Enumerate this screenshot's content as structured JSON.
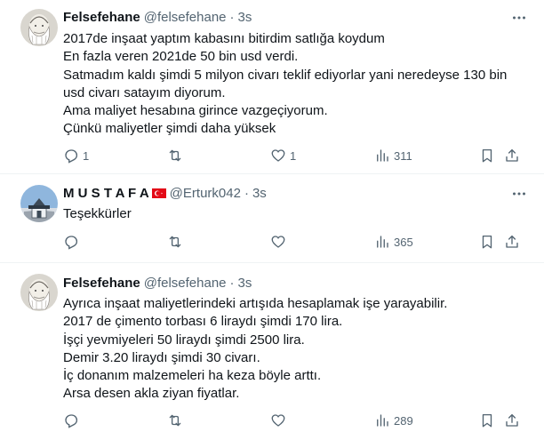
{
  "tweets": [
    {
      "name": "Felsefehane",
      "handle": "@felsefehane",
      "dot": "·",
      "time": "3s",
      "lines": [
        "2017de inşaat yaptım kabasını bitirdim satlığa koydum",
        "En fazla veren 2021de 50 bin usd verdi.",
        "Satmadım kaldı şimdi 5 milyon civarı teklif ediyorlar yani neredeyse 130 bin",
        "usd civarı satayım diyorum.",
        "Ama maliyet hesabına girince vazgeçiyorum.",
        "Çünkü maliyetler şimdi daha yüksek"
      ],
      "reply_count": "1",
      "retweet_count": "",
      "like_count": "1",
      "view_count": "311"
    },
    {
      "name": "M U S T A F A",
      "flag_icon": "turkey-flag-icon",
      "handle": "@Erturk042",
      "dot": "·",
      "time": "3s",
      "lines": [
        "Teşekkürler"
      ],
      "reply_count": "",
      "retweet_count": "",
      "like_count": "",
      "view_count": "365"
    },
    {
      "name": "Felsefehane",
      "handle": "@felsefehane",
      "dot": "·",
      "time": "3s",
      "lines": [
        "Ayrıca inşaat maliyetlerindeki artışıda hesaplamak işe yarayabilir.",
        "2017 de çimento torbası 6 liraydı şimdi 170 lira.",
        "İşçi yevmiyeleri 50 liraydı şimdi 2500 lira.",
        "Demir 3.20 liraydı şimdi 30 civarı.",
        "İç donanım malzemeleri ha keza böyle arttı.",
        "Arsa desen akla ziyan fiyatlar."
      ],
      "reply_count": "",
      "retweet_count": "",
      "like_count": "",
      "view_count": "289"
    }
  ],
  "colors": {
    "text": "#0f1419",
    "secondary": "#536471",
    "divider": "#eff3f4",
    "flag_red": "#e30a17"
  }
}
